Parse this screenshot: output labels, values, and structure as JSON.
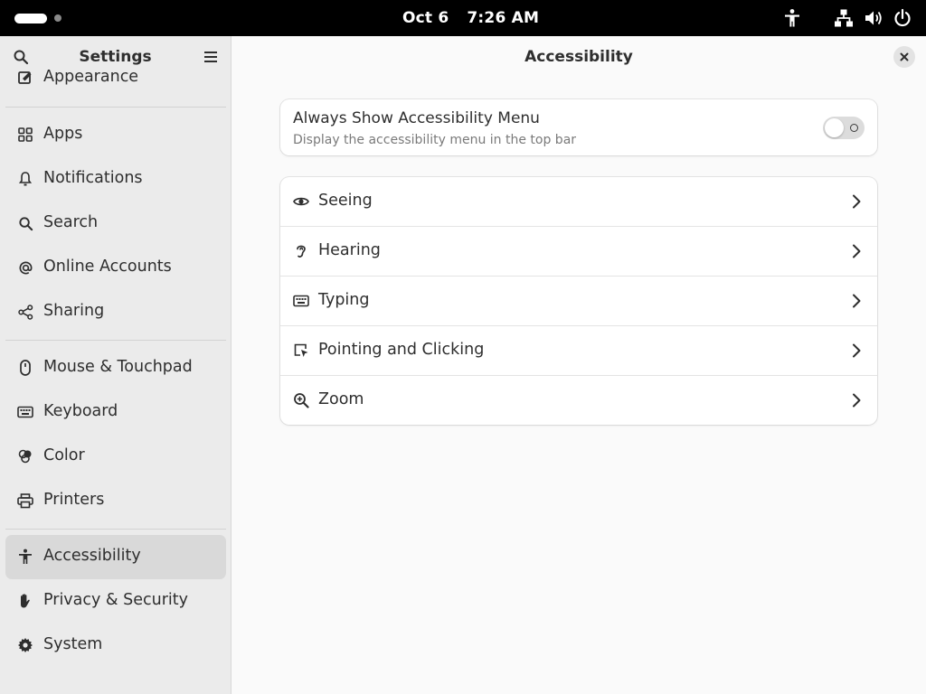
{
  "topbar": {
    "date": "Oct 6",
    "time": "7:26 AM",
    "icons": [
      "accessibility-icon",
      "network-icon",
      "volume-icon",
      "power-icon"
    ]
  },
  "sidebar": {
    "title": "Settings",
    "items": [
      {
        "label": "Appearance",
        "icon": "appearance-icon"
      },
      {
        "label": "Apps",
        "icon": "apps-icon"
      },
      {
        "label": "Notifications",
        "icon": "bell-icon"
      },
      {
        "label": "Search",
        "icon": "search-icon"
      },
      {
        "label": "Online Accounts",
        "icon": "at-icon"
      },
      {
        "label": "Sharing",
        "icon": "share-icon"
      },
      {
        "label": "Mouse & Touchpad",
        "icon": "mouse-icon"
      },
      {
        "label": "Keyboard",
        "icon": "keyboard-icon"
      },
      {
        "label": "Color",
        "icon": "color-icon"
      },
      {
        "label": "Printers",
        "icon": "printer-icon"
      },
      {
        "label": "Accessibility",
        "icon": "accessibility-icon",
        "selected": true
      },
      {
        "label": "Privacy & Security",
        "icon": "hand-icon"
      },
      {
        "label": "System",
        "icon": "gear-icon"
      }
    ]
  },
  "main": {
    "title": "Accessibility",
    "menu_toggle": {
      "title": "Always Show Accessibility Menu",
      "subtitle": "Display the accessibility menu in the top bar",
      "enabled": false
    },
    "rows": [
      {
        "label": "Seeing",
        "icon": "eye-icon"
      },
      {
        "label": "Hearing",
        "icon": "ear-icon"
      },
      {
        "label": "Typing",
        "icon": "keyboard-icon"
      },
      {
        "label": "Pointing and Clicking",
        "icon": "pointer-icon"
      },
      {
        "label": "Zoom",
        "icon": "zoom-icon"
      }
    ]
  },
  "colors": {
    "topbar": "#000000",
    "sidebar_bg": "#ebebeb",
    "selected_bg": "#d9d9d9",
    "content_bg": "#fafafa",
    "card_bg": "#ffffff"
  }
}
